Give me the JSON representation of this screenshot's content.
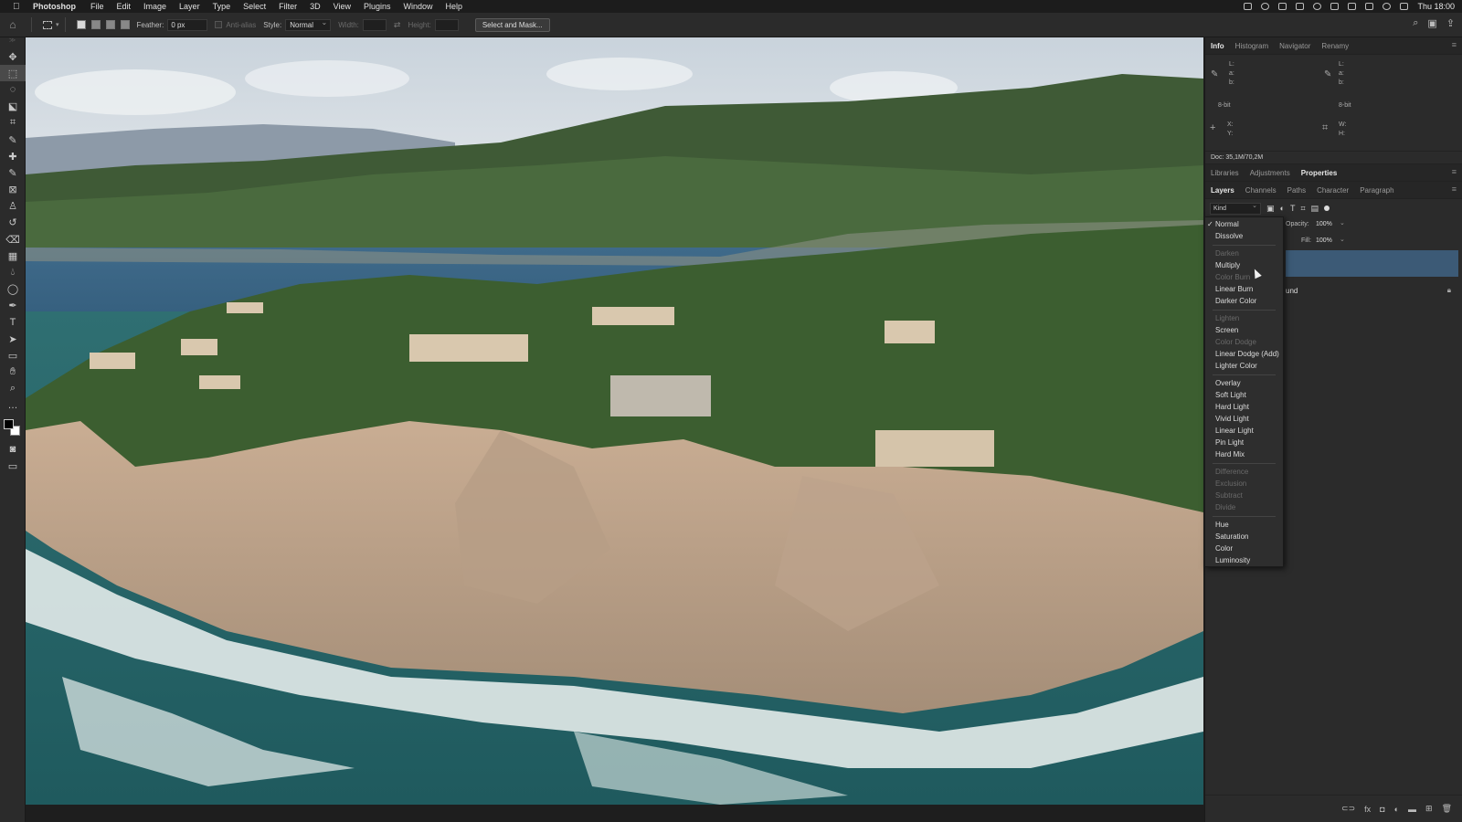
{
  "menubar": {
    "apple": "",
    "items": [
      "Photoshop",
      "File",
      "Edit",
      "Image",
      "Layer",
      "Type",
      "Select",
      "Filter",
      "3D",
      "View",
      "Plugins",
      "Window",
      "Help"
    ],
    "clock": "Thu 18:00"
  },
  "options": {
    "feather_label": "Feather:",
    "feather_value": "0 px",
    "antialias_label": "Anti-alias",
    "style_label": "Style:",
    "style_value": "Normal",
    "width_label": "Width:",
    "height_label": "Height:",
    "select_mask_label": "Select and Mask..."
  },
  "info_panel": {
    "tabs": [
      "Info",
      "Histogram",
      "Navigator",
      "Renamy"
    ],
    "active_tab": "Info",
    "lab_left": [
      "L:",
      "a:",
      "b:"
    ],
    "lab_right": [
      "L:",
      "a:",
      "b:"
    ],
    "bits_left": "8-bit",
    "bits_right": "8-bit",
    "xy": [
      "X:",
      "Y:"
    ],
    "wh": [
      "W:",
      "H:"
    ],
    "doc": "Doc: 35,1M/70,2M"
  },
  "props_panel": {
    "tabs": [
      "Libraries",
      "Adjustments",
      "Properties"
    ],
    "active_tab": "Properties"
  },
  "layers_panel": {
    "tabs": [
      "Layers",
      "Channels",
      "Paths",
      "Character",
      "Paragraph"
    ],
    "active_tab": "Layers",
    "kind": "Kind",
    "opacity_label": "Opacity:",
    "opacity_value": "100%",
    "fill_label": "Fill:",
    "fill_value": "100%",
    "background_layer": "und"
  },
  "blend_modes": {
    "selected": "Normal",
    "groups": [
      [
        {
          "label": "Normal",
          "enabled": true
        },
        {
          "label": "Dissolve",
          "enabled": true
        }
      ],
      [
        {
          "label": "Darken",
          "enabled": false
        },
        {
          "label": "Multiply",
          "enabled": true
        },
        {
          "label": "Color Burn",
          "enabled": false
        },
        {
          "label": "Linear Burn",
          "enabled": true
        },
        {
          "label": "Darker Color",
          "enabled": true
        }
      ],
      [
        {
          "label": "Lighten",
          "enabled": false
        },
        {
          "label": "Screen",
          "enabled": true
        },
        {
          "label": "Color Dodge",
          "enabled": false
        },
        {
          "label": "Linear Dodge (Add)",
          "enabled": true
        },
        {
          "label": "Lighter Color",
          "enabled": true
        }
      ],
      [
        {
          "label": "Overlay",
          "enabled": true
        },
        {
          "label": "Soft Light",
          "enabled": true
        },
        {
          "label": "Hard Light",
          "enabled": true
        },
        {
          "label": "Vivid Light",
          "enabled": true
        },
        {
          "label": "Linear Light",
          "enabled": true
        },
        {
          "label": "Pin Light",
          "enabled": true
        },
        {
          "label": "Hard Mix",
          "enabled": true
        }
      ],
      [
        {
          "label": "Difference",
          "enabled": false
        },
        {
          "label": "Exclusion",
          "enabled": false
        },
        {
          "label": "Subtract",
          "enabled": false
        },
        {
          "label": "Divide",
          "enabled": false
        }
      ],
      [
        {
          "label": "Hue",
          "enabled": true
        },
        {
          "label": "Saturation",
          "enabled": true
        },
        {
          "label": "Color",
          "enabled": true
        },
        {
          "label": "Luminosity",
          "enabled": true
        }
      ]
    ]
  },
  "tools": [
    "move-tool",
    "rectangular-marquee-tool",
    "lasso-tool",
    "object-selection-tool",
    "crop-tool",
    "eyedropper-tool",
    "spot-healing-tool",
    "brush-tool",
    "frame-tool",
    "clone-stamp-tool",
    "history-brush-tool",
    "eraser-tool",
    "gradient-tool",
    "blur-tool",
    "dodge-tool",
    "pen-tool",
    "type-tool",
    "path-selection-tool",
    "shape-tool",
    "hand-tool",
    "zoom-tool",
    "more-tools"
  ],
  "colors": {
    "accent": "#3c5a76",
    "panel": "#2b2b2b",
    "foreground": "#000000",
    "background": "#ffffff"
  }
}
